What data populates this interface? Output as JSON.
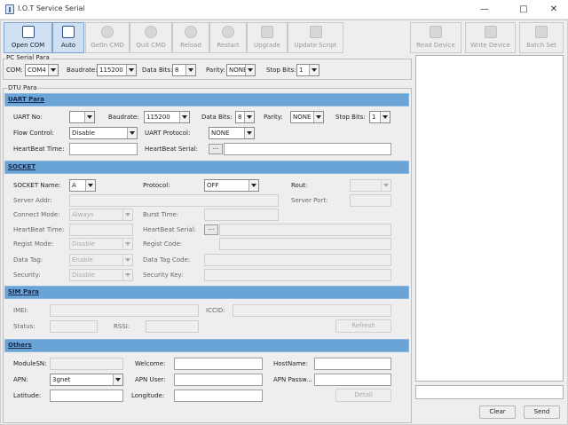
{
  "window": {
    "title": "I.O.T Service Serial",
    "minimize": "—",
    "maximize": "□",
    "close": "✕"
  },
  "toolbar": [
    {
      "id": "open-com",
      "label": "Open COM",
      "icon": "serial-port-icon",
      "active": true
    },
    {
      "id": "auto",
      "label": "Auto",
      "icon": "auto-icon",
      "active": true
    },
    {
      "id": "getin-cmd",
      "label": "GetIn CMD",
      "icon": "download-icon",
      "active": false
    },
    {
      "id": "quit-cmd",
      "label": "Quit CMD",
      "icon": "upload-icon",
      "active": false
    },
    {
      "id": "reload",
      "label": "Reload",
      "icon": "reload-icon",
      "active": false
    },
    {
      "id": "restart",
      "label": "Restart",
      "icon": "power-icon",
      "active": false
    },
    {
      "id": "upgrade",
      "label": "Upgrade",
      "icon": "upgrade-icon",
      "active": false
    },
    {
      "id": "update-script",
      "label": "Update Script",
      "icon": "script-icon",
      "active": false
    },
    {
      "id": "read-device",
      "label": "Read Device",
      "icon": "read-icon",
      "active": false
    },
    {
      "id": "write-device",
      "label": "Write Device",
      "icon": "write-icon",
      "active": false
    },
    {
      "id": "batch-set",
      "label": "Batch Set",
      "icon": "batch-icon",
      "active": false
    }
  ],
  "pc_serial": {
    "title": "PC Serial Para",
    "com_label": "COM:",
    "com_value": "COM4",
    "baud_label": "Baudrate:",
    "baud_value": "115200",
    "databits_label": "Data Bits:",
    "databits_value": "8",
    "parity_label": "Parity:",
    "parity_value": "NONE",
    "stopbits_label": "Stop Bits:",
    "stopbits_value": "1"
  },
  "dtu": {
    "title": "DTU Para",
    "uart": {
      "header": "UART Para",
      "uart_no_label": "UART No:",
      "uart_no_value": "",
      "baud_label": "Baudrate:",
      "baud_value": "115200",
      "databits_label": "Data Bits:",
      "databits_value": "8",
      "parity_label": "Parity:",
      "parity_value": "NONE",
      "stopbits_label": "Stop Bits:",
      "stopbits_value": "1",
      "flow_label": "Flow Control:",
      "flow_value": "Disable",
      "protocol_label": "UART Protocol:",
      "protocol_value": "NONE",
      "hb_time_label": "HeartBeat Time:",
      "hb_time_value": "",
      "hb_serial_label": "HeartBeat Serial:",
      "hb_serial_btn": "...",
      "hb_serial_value": ""
    },
    "socket": {
      "header": "SOCKET",
      "name_label": "SOCKET Name:",
      "name_value": "A",
      "protocol_label": "Protocol:",
      "protocol_value": "OFF",
      "rout_label": "Rout:",
      "rout_value": "",
      "server_addr_label": "Server Addr:",
      "server_port_label": "Server Port:",
      "connect_label": "Connect Mode:",
      "connect_value": "Always",
      "burst_label": "Burst Time:",
      "hb_time_label": "HeartBeat Time:",
      "hb_serial_label": "HeartBeat Serial:",
      "hb_serial_btn": "...",
      "regist_mode_label": "Regist Mode:",
      "regist_mode_value": "Disable",
      "regist_code_label": "Regist Code:",
      "data_tag_label": "Data Tag:",
      "data_tag_value": "Enable",
      "data_tag_code_label": "Data Tag Code:",
      "security_label": "Security:",
      "security_value": "Disable",
      "security_key_label": "Security Key:"
    },
    "sim": {
      "header": "SIM Para",
      "imei_label": "IMEI:",
      "iccid_label": "ICCID:",
      "status_label": "Status:",
      "rssi_label": "RSSI:",
      "refresh_btn": "Refresh"
    },
    "others": {
      "header": "Others",
      "module_sn_label": "ModuleSN:",
      "welcome_label": "Welcome:",
      "hostname_label": "HostName:",
      "apn_label": "APN:",
      "apn_value": "3gnet",
      "apn_user_label": "APN User:",
      "apn_pass_label": "APN Passw...",
      "latitude_label": "Latitude:",
      "longitude_label": "Longitude:",
      "detail_btn": "Detail"
    }
  },
  "console": {
    "clear_btn": "Clear",
    "send_btn": "Send"
  }
}
